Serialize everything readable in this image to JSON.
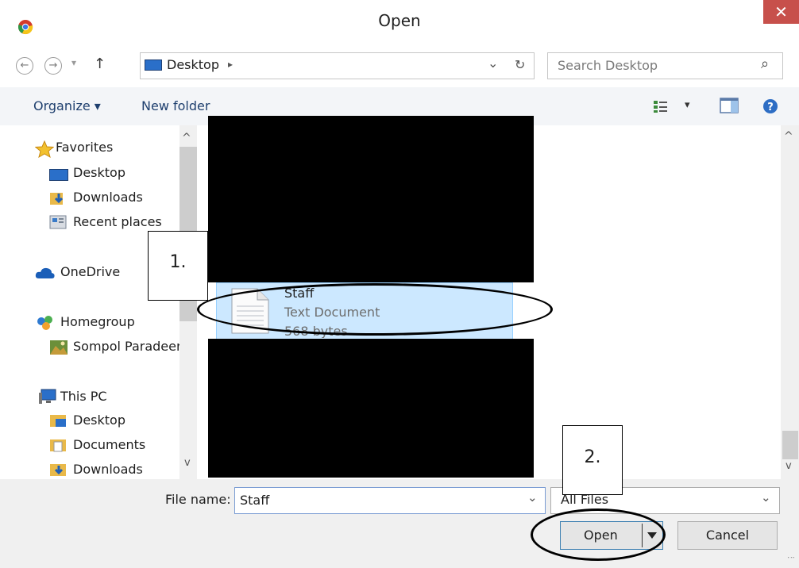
{
  "window": {
    "title": "Open",
    "close_label": "✕"
  },
  "nav": {
    "back": "←",
    "forward": "→",
    "dropdown": "▾",
    "up": "↑",
    "address": "Desktop",
    "address_sep": "▸",
    "address_dropdown": "⌄",
    "refresh": "↻",
    "search_placeholder": "Search Desktop",
    "search_icon": "⌕"
  },
  "toolbar": {
    "organize": "Organize ▾",
    "new_folder": "New folder",
    "view_dropdown": "▾"
  },
  "sidebar": {
    "favorites": "Favorites",
    "favorites_items": [
      "Desktop",
      "Downloads",
      "Recent places"
    ],
    "onedrive": "OneDrive",
    "homegroup": "Homegroup",
    "homegroup_items": [
      "Sompol Paradeer"
    ],
    "thispc": "This PC",
    "thispc_items": [
      "Desktop",
      "Documents",
      "Downloads"
    ],
    "scroll_up": "^",
    "scroll_down": "v"
  },
  "file": {
    "name": "Staff",
    "type": "Text Document",
    "size": "568 bytes"
  },
  "content_scroll": {
    "up": "^",
    "down": "v"
  },
  "bottom": {
    "filename_label": "File name:",
    "filename_value": "Staff",
    "filter_value": "All Files",
    "open_label": "Open",
    "cancel_label": "Cancel",
    "dropdown": "⌄"
  },
  "annotations": {
    "callout1": "1.",
    "callout2": "2."
  },
  "icons": {
    "favorites": "star-icon",
    "desktop": "desktop-icon",
    "downloads": "downloads-icon",
    "recent": "recent-places-icon",
    "onedrive": "cloud-icon",
    "homegroup": "homegroup-icon",
    "user": "user-avatar-icon",
    "thispc": "computer-icon",
    "documents": "documents-icon",
    "help": "help-icon",
    "chrome": "chrome-icon"
  }
}
